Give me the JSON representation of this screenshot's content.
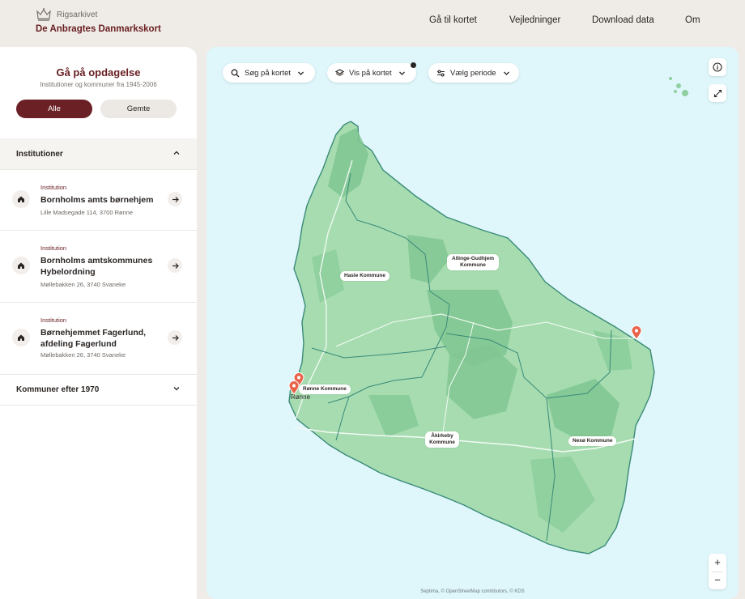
{
  "header": {
    "org_name": "Rigsarkivet",
    "site_title": "De Anbragtes Danmarkskort",
    "nav": [
      "Gå til kortet",
      "Vejledninger",
      "Download data",
      "Om"
    ]
  },
  "sidebar": {
    "title": "Gå på opdagelse",
    "subtitle": "Institutioner og kommuner fra 1945-2006",
    "filters": {
      "all": "Alle",
      "saved": "Gemte",
      "active": "all"
    },
    "sections": [
      {
        "title": "Institutioner",
        "expanded": true
      },
      {
        "title": "Kommuner efter 1970",
        "expanded": false
      }
    ],
    "institutions": [
      {
        "tag": "Institution",
        "name": "Bornholms amts børnehjem",
        "address": "Lille Madsegade 114, 3700 Rønne"
      },
      {
        "tag": "Institution",
        "name": "Bornholms amtskommunes Hybelordning",
        "address": "Møllebakken 26, 3740 Svaneke"
      },
      {
        "tag": "Institution",
        "name": "Børnehjemmet Fagerlund, afdeling Fagerlund",
        "address": "Møllebakken 26, 3740 Svaneke"
      }
    ]
  },
  "map": {
    "controls": {
      "search": "Søg på kortet",
      "show": "Vis på kortet",
      "period": "Vælg periode"
    },
    "municipalities": [
      "Hasle Kommune",
      "Allinge-Gudhjem Kommune",
      "Rønne Kommune",
      "Åkirkeby Kommune",
      "Nexø Kommune"
    ],
    "place_label": "Rønne",
    "attribution": "Septima, © OpenStreetMap contributors, © KDS",
    "zoom_in": "+",
    "zoom_out": "−",
    "colors": {
      "water": "#dff7fb",
      "land": "#a6dcb0",
      "forest": "#7fc692",
      "border": "#3a8a78",
      "pin": "#e8634a"
    }
  },
  "colors": {
    "brand": "#6a2024",
    "background": "#efebe6"
  }
}
